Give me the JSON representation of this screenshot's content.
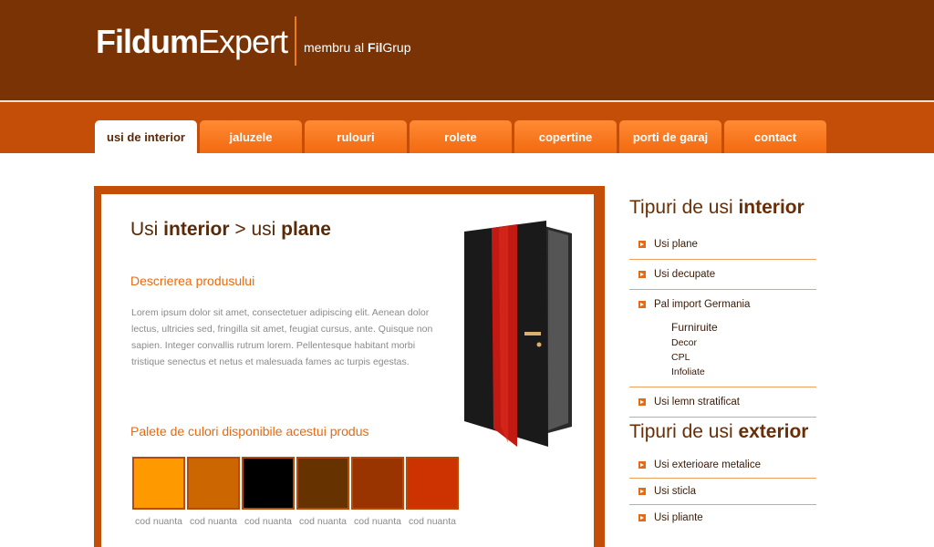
{
  "header": {
    "brand_bold": "Fildum",
    "brand_light": "Expert",
    "tagline_prefix": "membru al ",
    "tagline_fil": "Fil",
    "tagline_grup": "Grup"
  },
  "nav": {
    "tabs": [
      {
        "label": "usi de interior",
        "active": true
      },
      {
        "label": "jaluzele"
      },
      {
        "label": "rulouri"
      },
      {
        "label": "rolete"
      },
      {
        "label": "copertine"
      },
      {
        "label": "porti de garaj"
      },
      {
        "label": "contact"
      }
    ]
  },
  "main": {
    "title_a": "Usi ",
    "title_b": "interior",
    "title_c": " > usi ",
    "title_d": "plane",
    "description_heading": "Descrierea produsului",
    "description": "Lorem ipsum dolor sit amet, consectetuer adipiscing elit. Aenean dolor lectus, ultricies sed, fringilla sit amet, feugiat cursus, ante. Quisque non sapien. Integer convallis rutrum lorem. Pellentesque habitant morbi tristique senectus et netus et malesuada fames ac turpis egestas.",
    "palette_heading": "Palete de culori disponibile acestui produs",
    "swatches": [
      {
        "color": "#ff9900",
        "label": "cod nuanta"
      },
      {
        "color": "#cc6600",
        "label": "cod nuanta"
      },
      {
        "color": "#000000",
        "label": "cod nuanta"
      },
      {
        "color": "#663300",
        "label": "cod nuanta"
      },
      {
        "color": "#993300",
        "label": "cod nuanta"
      },
      {
        "color": "#cc3300",
        "label": "cod nuanta"
      }
    ]
  },
  "sidebar": {
    "interior_a": "Tipuri de usi ",
    "interior_b": "interior",
    "interior_items": [
      {
        "label": "Usi plane"
      },
      {
        "label": "Usi decupate"
      },
      {
        "label": "Pal import Germania",
        "sub_head": "Furniruite",
        "sub_items": [
          "Decor",
          "CPL",
          "Infoliate"
        ]
      },
      {
        "label": "Usi lemn stratificat"
      }
    ],
    "exterior_a": "Tipuri de usi ",
    "exterior_b": "exterior",
    "exterior_items": [
      {
        "label": "Usi exterioare metalice"
      },
      {
        "label": "Usi sticla"
      },
      {
        "label": "Usi pliante"
      }
    ]
  },
  "colors": {
    "header_brown": "#7a3304",
    "nav_orange": "#c44d07",
    "accent": "#e86a10"
  }
}
